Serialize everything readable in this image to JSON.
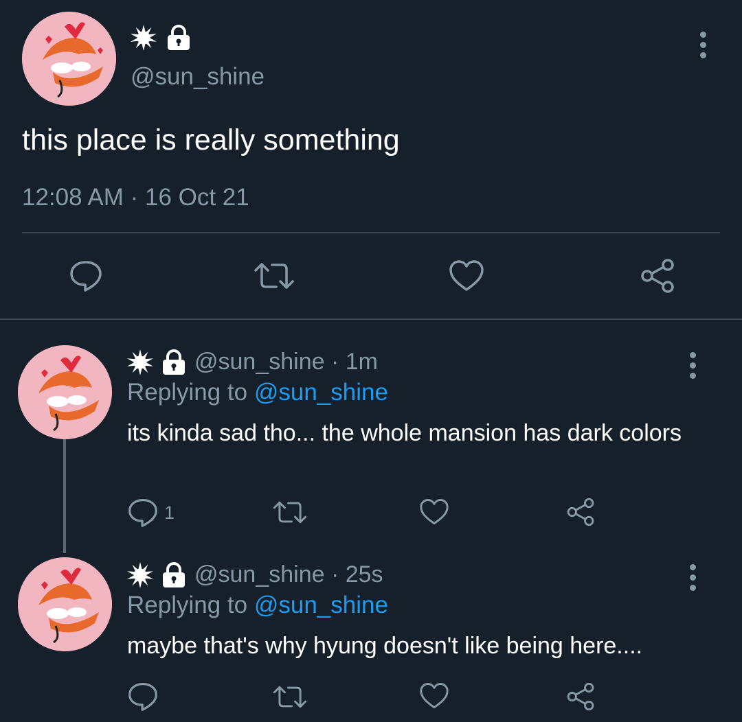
{
  "main_tweet": {
    "handle": "@sun_shine",
    "text": "this place is really something",
    "timestamp": "12:08 AM · 16 Oct 21",
    "icons": [
      "sun-icon",
      "lock-icon",
      "more-icon",
      "comment-icon",
      "retweet-icon",
      "heart-icon",
      "share-icon"
    ]
  },
  "replies": [
    {
      "handle_time": "@sun_shine · 1m",
      "replying_prefix": "Replying to ",
      "replying_to": "@sun_shine",
      "text": "its kinda sad tho... the whole mansion has dark colors",
      "comment_count": "1"
    },
    {
      "handle_time": "@sun_shine · 25s",
      "replying_prefix": "Replying to ",
      "replying_to": "@sun_shine",
      "text": "maybe that's why hyung doesn't like being here....",
      "comment_count": ""
    }
  ],
  "colors": {
    "background": "#15202b",
    "text": "#ffffff",
    "muted": "#8899a6",
    "link": "#1d9bf0",
    "divider": "#38444d"
  }
}
